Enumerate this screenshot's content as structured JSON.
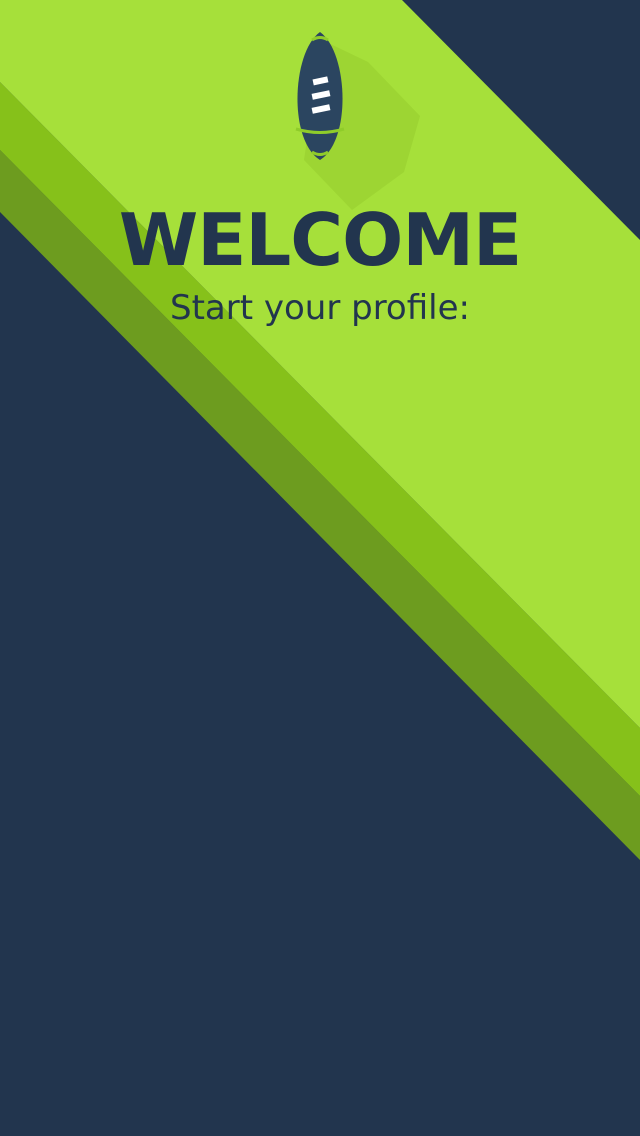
{
  "welcome": {
    "title": "WELCOME",
    "subtitle": "Start your profile:"
  },
  "logo": {
    "icon": "football-icon"
  },
  "colors": {
    "background_navy": "#22354e",
    "accent_lime": "#a6e03a",
    "stripe_mid": "#86c11a",
    "stripe_dark": "#6d9c1f"
  }
}
